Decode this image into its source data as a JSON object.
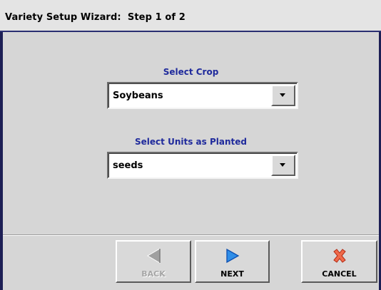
{
  "window": {
    "title": "Variety Setup Wizard:  Step 1 of 2"
  },
  "crop": {
    "label": "Select Crop",
    "value": "Soybeans"
  },
  "units": {
    "label": "Select Units as Planted",
    "value": "seeds"
  },
  "buttons": {
    "back": {
      "label": "BACK",
      "enabled": false
    },
    "next": {
      "label": "NEXT",
      "enabled": true
    },
    "cancel": {
      "label": "CANCEL",
      "enabled": true
    }
  },
  "icons": {
    "back": "arrow-left-icon",
    "next": "arrow-right-icon",
    "cancel": "x-icon",
    "dropdown": "chevron-down-icon"
  },
  "colors": {
    "accent_text": "#1f2a9c",
    "frame": "#1d1f55",
    "next_arrow": "#1e88e5",
    "cancel_x": "#e53935"
  }
}
